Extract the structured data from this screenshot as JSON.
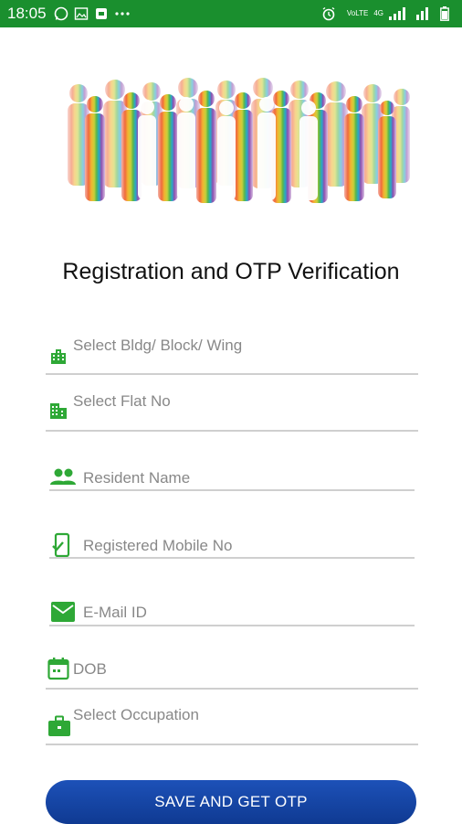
{
  "status_bar": {
    "time": "18:05",
    "network_label_top": "VoLTE",
    "network_label_4g": "4G"
  },
  "title": "Registration and OTP Verification",
  "form": {
    "bldg": {
      "placeholder": "Select Bldg/ Block/ Wing",
      "icon": "building-icon"
    },
    "flat": {
      "placeholder": "Select Flat No",
      "icon": "apartment-icon"
    },
    "resident": {
      "placeholder": "Resident Name",
      "icon": "people-icon"
    },
    "mobile": {
      "placeholder": "Registered Mobile No",
      "icon": "mobile-check-icon"
    },
    "email": {
      "placeholder": "E-Mail ID",
      "icon": "email-icon"
    },
    "dob": {
      "placeholder": "DOB",
      "icon": "calendar-icon"
    },
    "occupation": {
      "placeholder": "Select Occupation",
      "icon": "briefcase-icon"
    }
  },
  "submit_label": "SAVE AND GET OTP",
  "colors": {
    "status_bar": "#1a8f2e",
    "icon_green": "#2ea836",
    "button": "#1d51b8"
  }
}
